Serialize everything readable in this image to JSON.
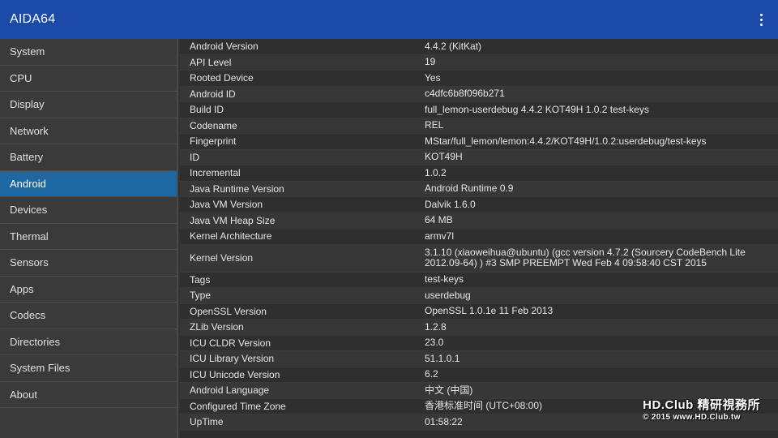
{
  "app": {
    "title": "AIDA64",
    "menu_icon": "overflow-menu-icon"
  },
  "sidebar": {
    "items": [
      {
        "label": "System"
      },
      {
        "label": "CPU"
      },
      {
        "label": "Display"
      },
      {
        "label": "Network"
      },
      {
        "label": "Battery"
      },
      {
        "label": "Android"
      },
      {
        "label": "Devices"
      },
      {
        "label": "Thermal"
      },
      {
        "label": "Sensors"
      },
      {
        "label": "Apps"
      },
      {
        "label": "Codecs"
      },
      {
        "label": "Directories"
      },
      {
        "label": "System Files"
      },
      {
        "label": "About"
      }
    ],
    "active_index": 5
  },
  "details": [
    {
      "label": "Android Version",
      "value": "4.4.2 (KitKat)"
    },
    {
      "label": "API Level",
      "value": "19"
    },
    {
      "label": "Rooted Device",
      "value": "Yes"
    },
    {
      "label": "Android ID",
      "value": "c4dfc6b8f096b271"
    },
    {
      "label": "Build ID",
      "value": "full_lemon-userdebug 4.4.2 KOT49H 1.0.2 test-keys"
    },
    {
      "label": "Codename",
      "value": "REL"
    },
    {
      "label": "Fingerprint",
      "value": "MStar/full_lemon/lemon:4.4.2/KOT49H/1.0.2:userdebug/test-keys"
    },
    {
      "label": "ID",
      "value": "KOT49H"
    },
    {
      "label": "Incremental",
      "value": "1.0.2"
    },
    {
      "label": "Java Runtime Version",
      "value": "Android Runtime 0.9"
    },
    {
      "label": "Java VM Version",
      "value": "Dalvik 1.6.0"
    },
    {
      "label": "Java VM Heap Size",
      "value": "64 MB"
    },
    {
      "label": "Kernel Architecture",
      "value": "armv7l"
    },
    {
      "label": "Kernel Version",
      "value": "3.1.10 (xiaoweihua@ubuntu) (gcc version 4.7.2 (Sourcery CodeBench Lite 2012.09-64) ) #3 SMP PREEMPT Wed Feb 4 09:58:40 CST 2015"
    },
    {
      "label": "Tags",
      "value": "test-keys"
    },
    {
      "label": "Type",
      "value": "userdebug"
    },
    {
      "label": "OpenSSL Version",
      "value": "OpenSSL 1.0.1e 11 Feb 2013"
    },
    {
      "label": "ZLib Version",
      "value": "1.2.8"
    },
    {
      "label": "ICU CLDR Version",
      "value": "23.0"
    },
    {
      "label": "ICU Library Version",
      "value": "51.1.0.1"
    },
    {
      "label": "ICU Unicode Version",
      "value": "6.2"
    },
    {
      "label": "Android Language",
      "value": "中文 (中国)"
    },
    {
      "label": "Configured Time Zone",
      "value": "香港标准时间 (UTC+08:00)"
    },
    {
      "label": "UpTime",
      "value": "01:58:22"
    }
  ],
  "watermark": {
    "line1": "HD.Club 精研視務所",
    "line2": "© 2015  www.HD.Club.tw"
  }
}
